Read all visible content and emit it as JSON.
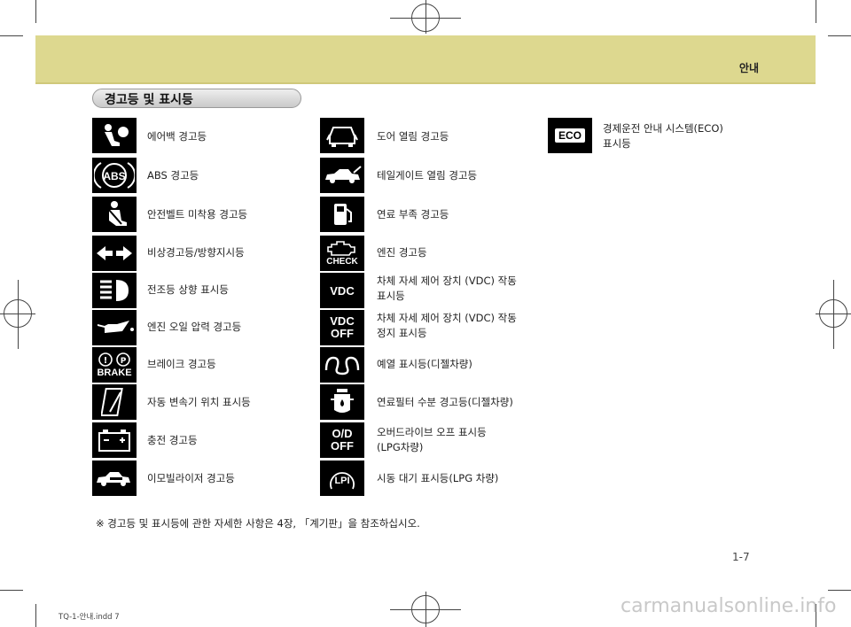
{
  "header": {
    "section_label": "안내"
  },
  "title": "경고등 및 표시등",
  "columns": [
    {
      "items": [
        {
          "icon": "airbag-warning-icon",
          "label": "에어백 경고등"
        },
        {
          "icon": "abs-warning-icon",
          "icon_text": "ABS",
          "label": "ABS 경고등"
        },
        {
          "icon": "seatbelt-warning-icon",
          "label": "안전벨트 미착용 경고등"
        },
        {
          "icon": "hazard-turn-signal-icon",
          "label": "비상경고등/방향지시등"
        },
        {
          "icon": "high-beam-icon",
          "label": "전조등 상향 표시등"
        },
        {
          "icon": "oil-pressure-warning-icon",
          "label": "엔진 오일 압력 경고등"
        },
        {
          "icon": "brake-warning-icon",
          "icon_text": "BRAKE",
          "label": "브레이크 경고등"
        },
        {
          "icon": "shift-position-icon",
          "label": "자동 변속기 위치 표시등"
        },
        {
          "icon": "battery-charge-warning-icon",
          "label": "충전 경고등"
        },
        {
          "icon": "immobilizer-warning-icon",
          "label": "이모빌라이저 경고등"
        }
      ]
    },
    {
      "items": [
        {
          "icon": "door-open-warning-icon",
          "label": "도어  열림 경고등"
        },
        {
          "icon": "tailgate-open-warning-icon",
          "label": "테일게이트 열림 경고등"
        },
        {
          "icon": "low-fuel-warning-icon",
          "label": "연료 부족 경고등"
        },
        {
          "icon": "check-engine-warning-icon",
          "icon_text": "CHECK",
          "label": "엔진 경고등"
        },
        {
          "icon": "vdc-indicator-icon",
          "icon_text": "VDC",
          "label_line1": "차체 자세 제어 장치 (VDC) 작동",
          "label_line2": "표시등"
        },
        {
          "icon": "vdc-off-indicator-icon",
          "icon_text_1": "VDC",
          "icon_text_2": "OFF",
          "label_line1": "차체 자세 제어 장치 (VDC) 작동",
          "label_line2": "정지 표시등"
        },
        {
          "icon": "glow-plug-indicator-icon",
          "label": "예열 표시등(디젤차량)"
        },
        {
          "icon": "fuel-filter-water-warning-icon",
          "label": "연료필터 수분 경고등(디젤차량)"
        },
        {
          "icon": "overdrive-off-indicator-icon",
          "icon_text_1": "O/D",
          "icon_text_2": "OFF",
          "label_line1": "오버드라이브 오프 표시등",
          "label_line2": "(LPG차량)"
        },
        {
          "icon": "lpi-standby-indicator-icon",
          "icon_text": "LPI",
          "label": "시동 대기 표시등(LPG 차량)"
        }
      ]
    },
    {
      "items": [
        {
          "icon": "eco-indicator-icon",
          "icon_text": "ECO",
          "label_line1": "경제운전 안내 시스템(ECO)",
          "label_line2": "표시등"
        }
      ]
    }
  ],
  "footnote": "※ 경고등 및 표시등에 관한 자세한 사항은 4장, 「계기판」을 참조하십시오.",
  "page_number": "1-7",
  "file_info": "TQ-1-안내.indd   7",
  "watermark": "carmanualsonline.info",
  "colors": {
    "band": "#ddd88f",
    "icon_bg": "#000000",
    "icon_fg": "#ffffff"
  }
}
